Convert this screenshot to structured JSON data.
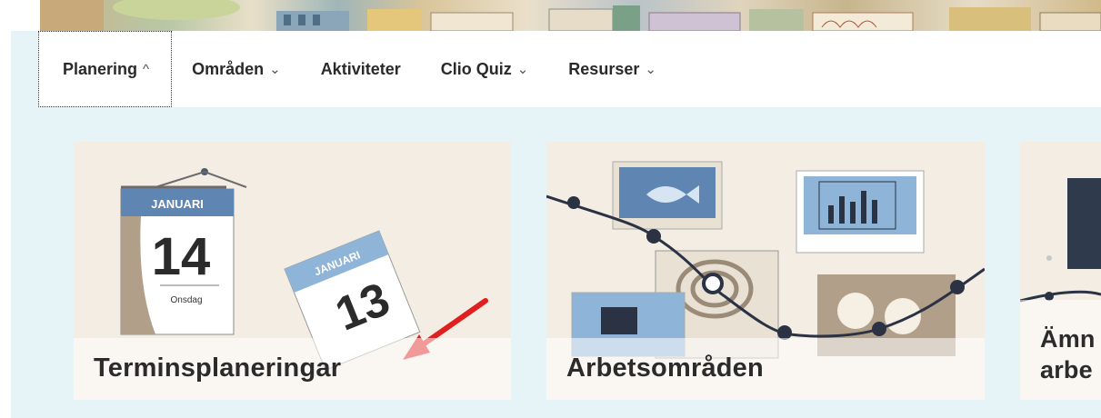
{
  "nav": {
    "items": [
      {
        "label": "Planering",
        "caret": "^",
        "active": true
      },
      {
        "label": "Områden",
        "caret": "⌄"
      },
      {
        "label": "Aktiviteter",
        "caret": ""
      },
      {
        "label": "Clio Quiz",
        "caret": "⌄"
      },
      {
        "label": "Resurser",
        "caret": "⌄"
      }
    ]
  },
  "cards": [
    {
      "title": "Terminsplaneringar",
      "calendar_back": {
        "month": "JANUARI",
        "day": "14",
        "weekday": "Onsdag"
      },
      "calendar_front": {
        "month": "JANUARI",
        "day": "13"
      }
    },
    {
      "title": "Arbetsområden"
    },
    {
      "title_line1": "Ämn",
      "title_line2": "arbe"
    }
  ],
  "colors": {
    "panel_bg": "#e6f3f7",
    "card_bg": "#f3ede3",
    "arrow": "#e02020",
    "calendar_blue": "#4a6f9a",
    "dark_line": "#2a3244"
  }
}
